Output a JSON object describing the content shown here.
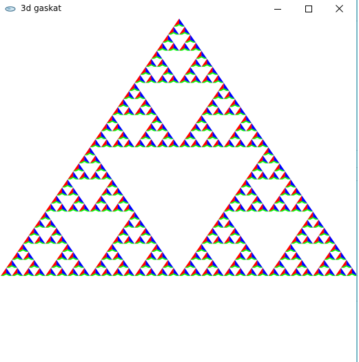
{
  "window": {
    "title": "3d gaskat",
    "app_icon": "opengl-app-icon",
    "buttons": {
      "minimize_icon": "minimize-icon",
      "maximize_icon": "maximize-icon",
      "close_icon": "close-icon"
    }
  },
  "canvas": {
    "background": "#ffffff",
    "colors": {
      "red": "#ff0000",
      "green": "#00ff00",
      "blue": "#0000ff"
    },
    "subdivision_depth": 5
  }
}
